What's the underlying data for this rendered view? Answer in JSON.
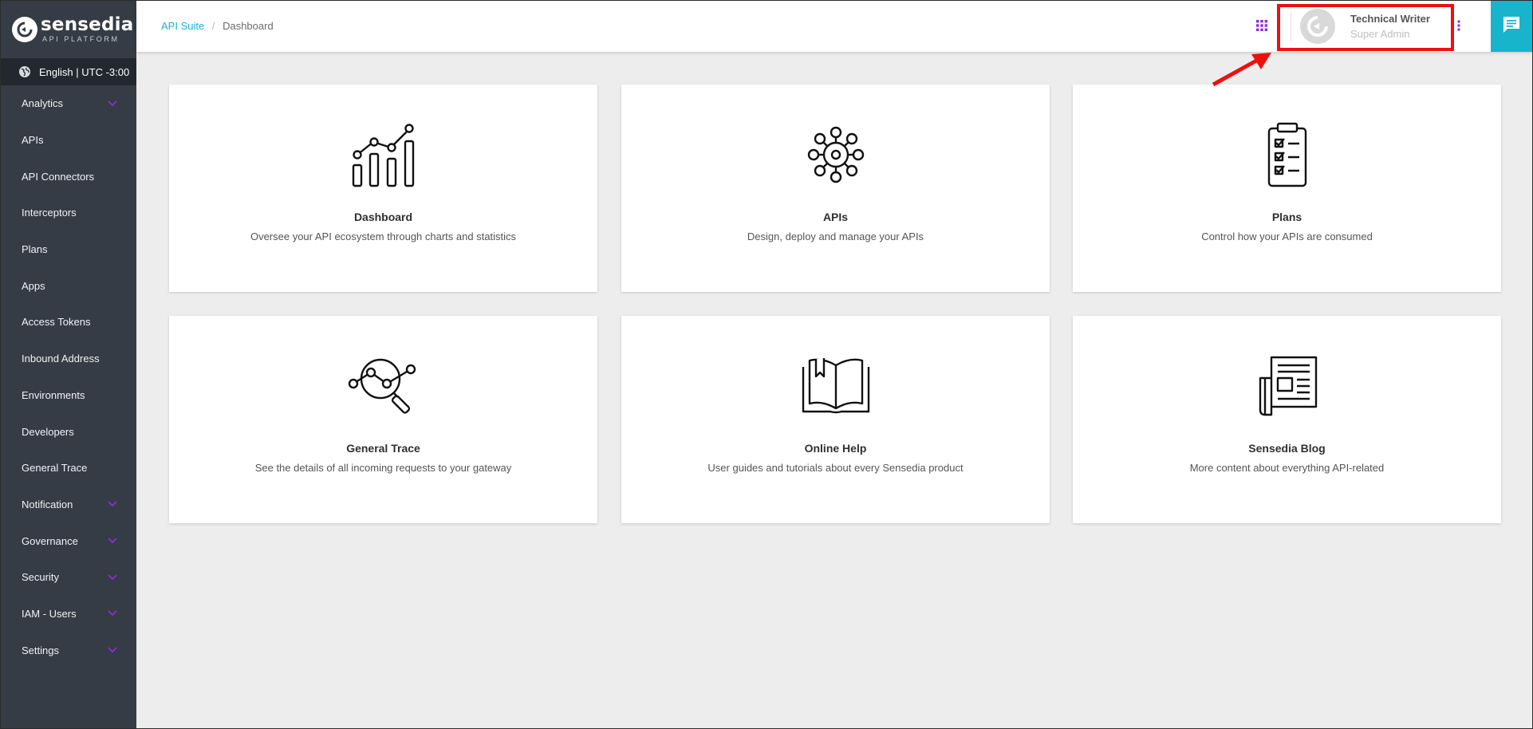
{
  "brand": {
    "name": "sensedia",
    "subtitle": "API PLATFORM"
  },
  "locale": {
    "label": "English | UTC -3:00"
  },
  "sidebar": {
    "items": [
      {
        "label": "Analytics",
        "has_children": true
      },
      {
        "label": "APIs",
        "has_children": false
      },
      {
        "label": "API Connectors",
        "has_children": false
      },
      {
        "label": "Interceptors",
        "has_children": false
      },
      {
        "label": "Plans",
        "has_children": false
      },
      {
        "label": "Apps",
        "has_children": false
      },
      {
        "label": "Access Tokens",
        "has_children": false
      },
      {
        "label": "Inbound Address",
        "has_children": false
      },
      {
        "label": "Environments",
        "has_children": false
      },
      {
        "label": "Developers",
        "has_children": false
      },
      {
        "label": "General Trace",
        "has_children": false
      },
      {
        "label": "Notification",
        "has_children": true
      },
      {
        "label": "Governance",
        "has_children": true
      },
      {
        "label": "Security",
        "has_children": true
      },
      {
        "label": "IAM - Users",
        "has_children": true
      },
      {
        "label": "Settings",
        "has_children": true
      }
    ]
  },
  "header": {
    "breadcrumb": {
      "root": "API Suite",
      "separator": "/",
      "current": "Dashboard"
    },
    "user": {
      "name": "Technical Writer",
      "role": "Super Admin"
    }
  },
  "cards": [
    {
      "title": "Dashboard",
      "description": "Oversee your API ecosystem through charts and statistics",
      "icon": "chart-icon"
    },
    {
      "title": "APIs",
      "description": "Design, deploy and manage your APIs",
      "icon": "gear-network-icon"
    },
    {
      "title": "Plans",
      "description": "Control how your APIs are consumed",
      "icon": "clipboard-checklist-icon"
    },
    {
      "title": "General Trace",
      "description": "See the details of all incoming requests to your gateway",
      "icon": "magnifier-trace-icon"
    },
    {
      "title": "Online Help",
      "description": "User guides and tutorials about every Sensedia product",
      "icon": "open-book-icon"
    },
    {
      "title": "Sensedia Blog",
      "description": "More content about everything API-related",
      "icon": "newspaper-icon"
    }
  ],
  "colors": {
    "sidebar_bg": "#353c45",
    "locale_bg": "#23282e",
    "accent": "#18b4cc",
    "chevron": "#8b2fd6",
    "annotation": "#ee1010"
  }
}
